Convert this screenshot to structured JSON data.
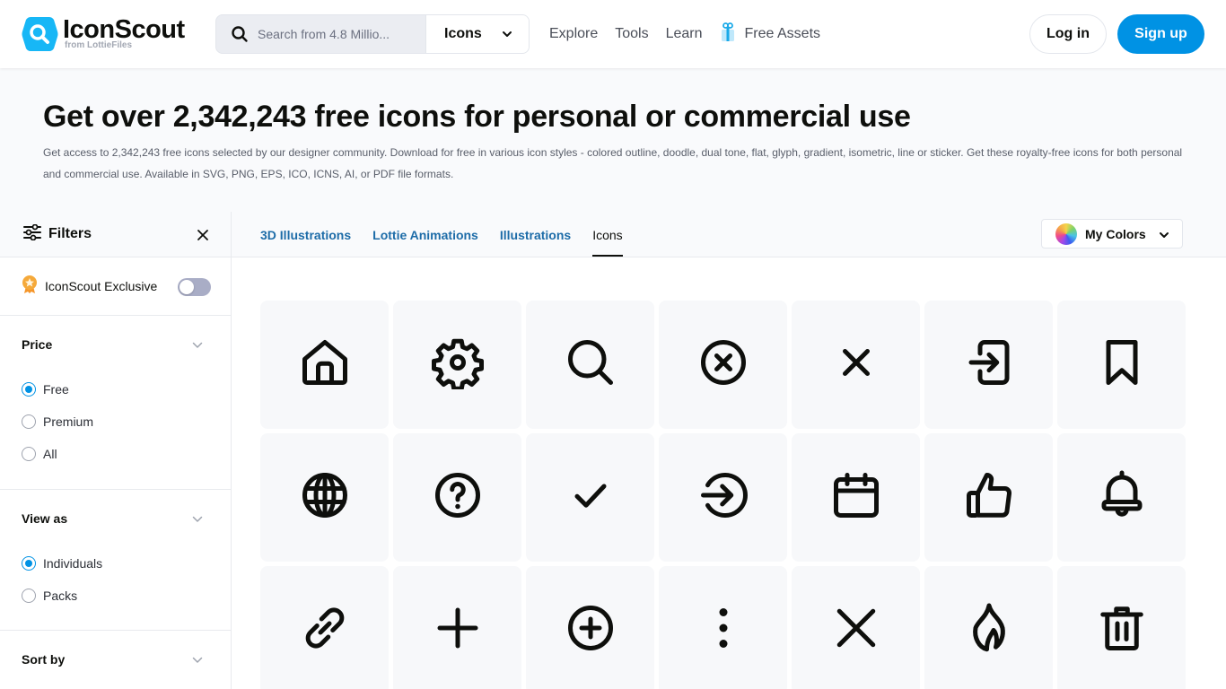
{
  "header": {
    "logo_title": "IconScout",
    "logo_subtitle": "from LottieFiles",
    "search_placeholder": "Search from 4.8 Millio...",
    "search_type": "Icons",
    "nav": [
      {
        "label": "Explore"
      },
      {
        "label": "Tools"
      },
      {
        "label": "Learn"
      },
      {
        "label": "Free Assets",
        "icon": "gift-icon"
      }
    ],
    "login_label": "Log in",
    "signup_label": "Sign up"
  },
  "hero": {
    "title": "Get over 2,342,243 free icons for personal or commercial use",
    "description": "Get access to 2,342,243 free icons selected by our designer community. Download for free in various icon styles - colored outline, doodle, dual tone, flat, glyph, gradient, isometric, line or sticker. Get these royalty-free icons for both personal and commercial use. Available in SVG, PNG, EPS, ICO, ICNS, AI, or PDF file formats."
  },
  "sidebar": {
    "filters_label": "Filters",
    "exclusive_label": "IconScout Exclusive",
    "exclusive_enabled": false,
    "price": {
      "title": "Price",
      "options": [
        "Free",
        "Premium",
        "All"
      ],
      "selected": "Free"
    },
    "view_as": {
      "title": "View as",
      "options": [
        "Individuals",
        "Packs"
      ],
      "selected": "Individuals"
    },
    "sort_by": {
      "title": "Sort by"
    }
  },
  "main": {
    "tabs": [
      {
        "label": "3D Illustrations",
        "active": false
      },
      {
        "label": "Lottie Animations",
        "active": false
      },
      {
        "label": "Illustrations",
        "active": false
      },
      {
        "label": "Icons",
        "active": true
      }
    ],
    "my_colors_label": "My Colors",
    "icons": [
      "home",
      "settings",
      "search",
      "close-circle",
      "close",
      "login",
      "bookmark",
      "globe",
      "help-circle",
      "check",
      "arrow-right-circle",
      "calendar",
      "thumbs-up",
      "bell",
      "link",
      "plus",
      "plus-circle",
      "more-vertical",
      "x",
      "fire",
      "trash"
    ]
  },
  "colors": {
    "brand_blue": "#0092e4",
    "logo_cyan": "#17b7f6",
    "tab_link": "#1d6ca8",
    "toggle_off": "#a9adc6",
    "exclusive_badge": "#f5962a"
  }
}
